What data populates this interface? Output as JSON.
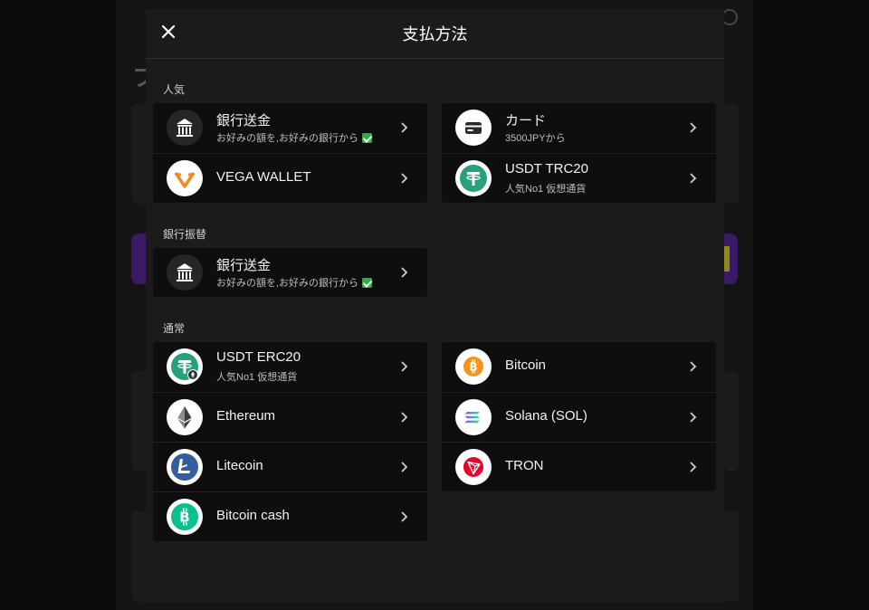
{
  "modal": {
    "title": "支払方法"
  },
  "background": {
    "title_fragment": "フ"
  },
  "sections": {
    "popular": {
      "label": "人気",
      "left": [
        {
          "title": "銀行送金",
          "subtitle": "お好みの額を,お好みの銀行から",
          "icon": "bank-icon",
          "verified": true
        },
        {
          "title": "VEGA WALLET",
          "subtitle": "",
          "icon": "vega-wallet-icon"
        }
      ],
      "right": [
        {
          "title": "カード",
          "subtitle": "3500JPYから",
          "icon": "card-icon"
        },
        {
          "title": "USDT TRC20",
          "subtitle": "人気No1 仮想通貨",
          "icon": "tether-icon"
        }
      ]
    },
    "bank": {
      "label": "銀行振替",
      "left": [
        {
          "title": "銀行送金",
          "subtitle": "お好みの額を,お好みの銀行から",
          "icon": "bank-icon",
          "verified": true
        }
      ]
    },
    "normal": {
      "label": "通常",
      "left": [
        {
          "title": "USDT ERC20",
          "subtitle": "人気No1 仮想通貨",
          "icon": "tether-erc20-icon"
        },
        {
          "title": "Ethereum",
          "subtitle": "",
          "icon": "ethereum-icon"
        },
        {
          "title": "Litecoin",
          "subtitle": "",
          "icon": "litecoin-icon"
        },
        {
          "title": "Bitcoin cash",
          "subtitle": "",
          "icon": "bitcoin-cash-icon"
        }
      ],
      "right": [
        {
          "title": "Bitcoin",
          "subtitle": "",
          "icon": "bitcoin-icon"
        },
        {
          "title": "Solana (SOL)",
          "subtitle": "",
          "icon": "solana-icon"
        },
        {
          "title": "TRON",
          "subtitle": "",
          "icon": "tron-icon"
        }
      ]
    }
  },
  "colors": {
    "modal_bg": "#1b1b1b",
    "card_bg": "#0e0e0e",
    "tether": "#26a17b",
    "bitcoin": "#f7931a",
    "litecoin": "#345d9d",
    "bitcoin_cash": "#0ac18e",
    "tron": "#eb0029",
    "vega": "#f08a24",
    "verified": "#3aa94a"
  }
}
